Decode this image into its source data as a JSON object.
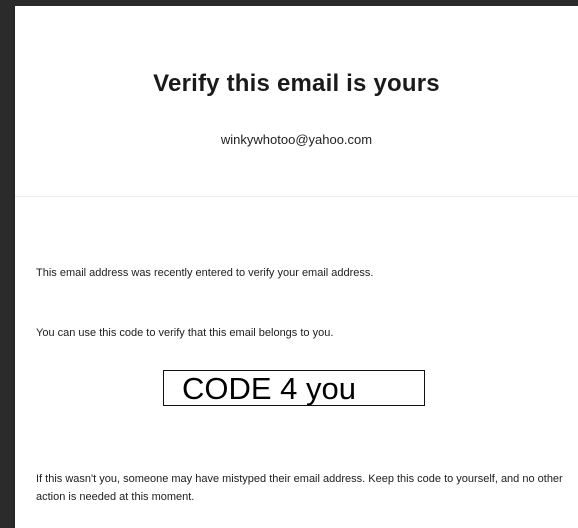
{
  "email": {
    "title": "Verify this email is yours",
    "address": "winkywhotoo@yahoo.com",
    "body": {
      "paragraph1": "This email address was recently entered to verify your email address.",
      "paragraph2": "You can use this code to verify that this email belongs to you.",
      "code": "CODE 4 you",
      "paragraph3": "If this wasn't you, someone may have mistyped their email address. Keep this code to yourself, and no other action is needed at this moment."
    }
  },
  "colors": {
    "background": "#262626",
    "card": "#ffffff",
    "text": "#1a1a1a",
    "code_border": "#111111"
  }
}
